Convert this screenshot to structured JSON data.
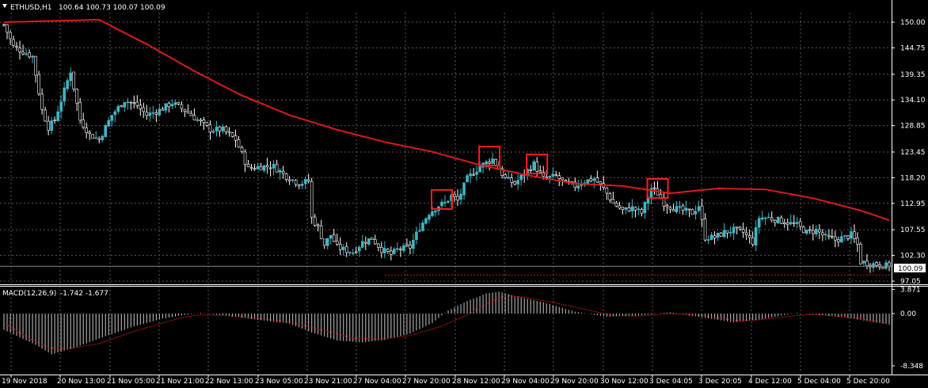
{
  "header": {
    "symbol_label": "ETHUSD,H1",
    "ohlc": "100.64 100.73 100.07 100.09"
  },
  "macd_header": {
    "label": "MACD(12,26,9)",
    "values": "-1.742 -1.677"
  },
  "current_price_label": "100.09",
  "colors": {
    "background": "#000000",
    "grid": "#5a5a5a",
    "bull": "#3fb6c6",
    "bear": "#ffffff",
    "moving_average": "#e01818",
    "highlight_box": "#ff1a1a",
    "macd_signal": "#c81414",
    "text": "#ffffff"
  },
  "chart_data": [
    {
      "type": "candlestick",
      "title": "ETHUSD,H1",
      "y_ticks": [
        "150.00",
        "144.75",
        "139.35",
        "134.10",
        "128.85",
        "123.45",
        "118.20",
        "112.95",
        "107.55",
        "102.30",
        "97.05"
      ],
      "ylim": [
        97.05,
        150.0
      ],
      "x_ticks": [
        "19 Nov 2018",
        "20 Nov 13:00",
        "21 Nov 05:00",
        "21 Nov 21:00",
        "22 Nov 13:00",
        "23 Nov 05:00",
        "23 Nov 21:00",
        "27 Nov 04:00",
        "27 Nov 20:00",
        "28 Nov 12:00",
        "29 Nov 04:00",
        "29 Nov 20:00",
        "30 Nov 12:00",
        "3 Dec 04:05",
        "3 Dec 20:05",
        "4 Dec 12:00",
        "5 Dec 04:00",
        "5 Dec 20:00"
      ],
      "grid": true,
      "price_profile": [
        [
          0,
          149.5
        ],
        [
          3,
          145
        ],
        [
          6,
          144
        ],
        [
          9,
          143
        ],
        [
          12,
          132
        ],
        [
          14,
          128.5
        ],
        [
          16,
          130
        ],
        [
          19,
          136
        ],
        [
          21,
          140
        ],
        [
          24,
          130
        ],
        [
          27,
          127
        ],
        [
          30,
          126
        ],
        [
          34,
          131
        ],
        [
          38,
          134
        ],
        [
          42,
          133
        ],
        [
          45,
          131
        ],
        [
          49,
          132
        ],
        [
          53,
          133.5
        ],
        [
          57,
          132
        ],
        [
          61,
          130
        ],
        [
          65,
          128
        ],
        [
          69,
          128
        ],
        [
          73,
          126
        ],
        [
          77,
          120
        ],
        [
          81,
          120.5
        ],
        [
          85,
          120.5
        ],
        [
          89,
          118.5
        ],
        [
          93,
          117
        ],
        [
          96,
          117.5
        ],
        [
          97,
          110
        ],
        [
          99,
          108
        ],
        [
          101,
          104.5
        ],
        [
          103,
          106.5
        ],
        [
          105,
          104
        ],
        [
          107,
          103.5
        ],
        [
          110,
          103
        ],
        [
          113,
          105
        ],
        [
          116,
          105.8
        ],
        [
          119,
          103.5
        ],
        [
          122,
          102.5
        ],
        [
          124,
          103.5
        ],
        [
          128,
          104
        ],
        [
          131,
          108
        ],
        [
          134,
          111
        ],
        [
          137,
          112.5
        ],
        [
          139,
          113
        ],
        [
          141,
          114.5
        ],
        [
          143,
          113.5
        ],
        [
          146,
          118
        ],
        [
          150,
          120.5
        ],
        [
          154,
          122
        ],
        [
          158,
          118
        ],
        [
          161,
          117
        ],
        [
          164,
          119
        ],
        [
          167,
          121
        ],
        [
          170,
          118
        ],
        [
          174,
          118.5
        ],
        [
          177,
          117
        ],
        [
          180,
          116.5
        ],
        [
          183,
          117.5
        ],
        [
          186,
          118
        ],
        [
          189,
          116
        ],
        [
          192,
          113
        ],
        [
          195,
          111.5
        ],
        [
          198,
          112
        ],
        [
          201,
          111
        ],
        [
          204,
          116
        ],
        [
          206,
          115
        ],
        [
          208,
          113
        ],
        [
          211,
          112
        ],
        [
          214,
          111.5
        ],
        [
          217,
          111
        ],
        [
          219,
          112.5
        ],
        [
          221,
          106
        ],
        [
          224,
          106
        ],
        [
          227,
          107
        ],
        [
          230,
          107.5
        ],
        [
          233,
          107
        ],
        [
          236,
          105
        ],
        [
          238,
          110
        ],
        [
          241,
          110
        ],
        [
          244,
          109.5
        ],
        [
          247,
          109
        ],
        [
          250,
          108.5
        ],
        [
          253,
          107
        ],
        [
          256,
          107.5
        ],
        [
          259,
          106
        ],
        [
          262,
          105.5
        ],
        [
          265,
          106
        ],
        [
          267,
          106.5
        ],
        [
          269,
          104.5
        ],
        [
          270,
          101
        ],
        [
          273,
          100.6
        ],
        [
          276,
          100.4
        ],
        [
          279,
          100.09
        ]
      ],
      "moving_average": [
        [
          0,
          150.0
        ],
        [
          30,
          150.5
        ],
        [
          45,
          145.5
        ],
        [
          60,
          140.0
        ],
        [
          75,
          135.0
        ],
        [
          90,
          131.0
        ],
        [
          105,
          128.0
        ],
        [
          120,
          125.5
        ],
        [
          135,
          123.5
        ],
        [
          150,
          120.8
        ],
        [
          165,
          118.7
        ],
        [
          180,
          117.0
        ],
        [
          195,
          116.5
        ],
        [
          210,
          115.0
        ],
        [
          225,
          116.0
        ],
        [
          240,
          115.8
        ],
        [
          255,
          114.0
        ],
        [
          270,
          111.5
        ],
        [
          279,
          109.5
        ]
      ],
      "highlight_boxes": [
        138,
        153,
        168,
        206
      ],
      "current_price": 100.09,
      "dotted_level": 98.3
    },
    {
      "type": "bar",
      "title": "MACD(12,26,9)",
      "y_ticks": [
        "3.871",
        "0.00",
        "-8.348"
      ],
      "ylim": [
        -8.348,
        3.871
      ],
      "histogram_profile": [
        [
          0,
          -2.6
        ],
        [
          5,
          -3.8
        ],
        [
          10,
          -5.0
        ],
        [
          15,
          -6.5
        ],
        [
          22,
          -5.5
        ],
        [
          30,
          -4.0
        ],
        [
          40,
          -2.2
        ],
        [
          50,
          -0.8
        ],
        [
          57,
          -0.2
        ],
        [
          62,
          0.1
        ],
        [
          70,
          -0.3
        ],
        [
          80,
          -1.0
        ],
        [
          90,
          -1.6
        ],
        [
          97,
          -3.0
        ],
        [
          105,
          -4.3
        ],
        [
          113,
          -4.6
        ],
        [
          120,
          -4.2
        ],
        [
          128,
          -3.2
        ],
        [
          135,
          -1.5
        ],
        [
          140,
          0.5
        ],
        [
          146,
          2.0
        ],
        [
          152,
          3.2
        ],
        [
          156,
          3.5
        ],
        [
          162,
          2.7
        ],
        [
          170,
          1.8
        ],
        [
          180,
          0.3
        ],
        [
          190,
          -0.5
        ],
        [
          200,
          -0.3
        ],
        [
          210,
          0.2
        ],
        [
          220,
          -0.6
        ],
        [
          230,
          -1.4
        ],
        [
          238,
          -1.0
        ],
        [
          245,
          -0.3
        ],
        [
          250,
          0.1
        ],
        [
          258,
          -0.3
        ],
        [
          265,
          -0.6
        ],
        [
          272,
          -1.2
        ],
        [
          279,
          -1.742
        ]
      ],
      "signal_profile": [
        [
          0,
          -1.5
        ],
        [
          8,
          -4.0
        ],
        [
          15,
          -5.6
        ],
        [
          22,
          -5.5
        ],
        [
          30,
          -4.8
        ],
        [
          40,
          -3.0
        ],
        [
          50,
          -1.5
        ],
        [
          57,
          -0.5
        ],
        [
          62,
          -0.2
        ],
        [
          70,
          -0.3
        ],
        [
          80,
          -0.8
        ],
        [
          90,
          -1.3
        ],
        [
          100,
          -2.6
        ],
        [
          110,
          -3.9
        ],
        [
          118,
          -4.1
        ],
        [
          128,
          -3.5
        ],
        [
          138,
          -2.0
        ],
        [
          146,
          -0.2
        ],
        [
          152,
          1.5
        ],
        [
          158,
          2.9
        ],
        [
          164,
          2.6
        ],
        [
          172,
          1.9
        ],
        [
          182,
          0.8
        ],
        [
          192,
          -0.3
        ],
        [
          200,
          -0.4
        ],
        [
          210,
          0.0
        ],
        [
          220,
          -0.3
        ],
        [
          230,
          -1.1
        ],
        [
          238,
          -1.0
        ],
        [
          248,
          -0.4
        ],
        [
          255,
          -0.1
        ],
        [
          265,
          -0.5
        ],
        [
          272,
          -1.0
        ],
        [
          279,
          -1.677
        ]
      ]
    }
  ]
}
